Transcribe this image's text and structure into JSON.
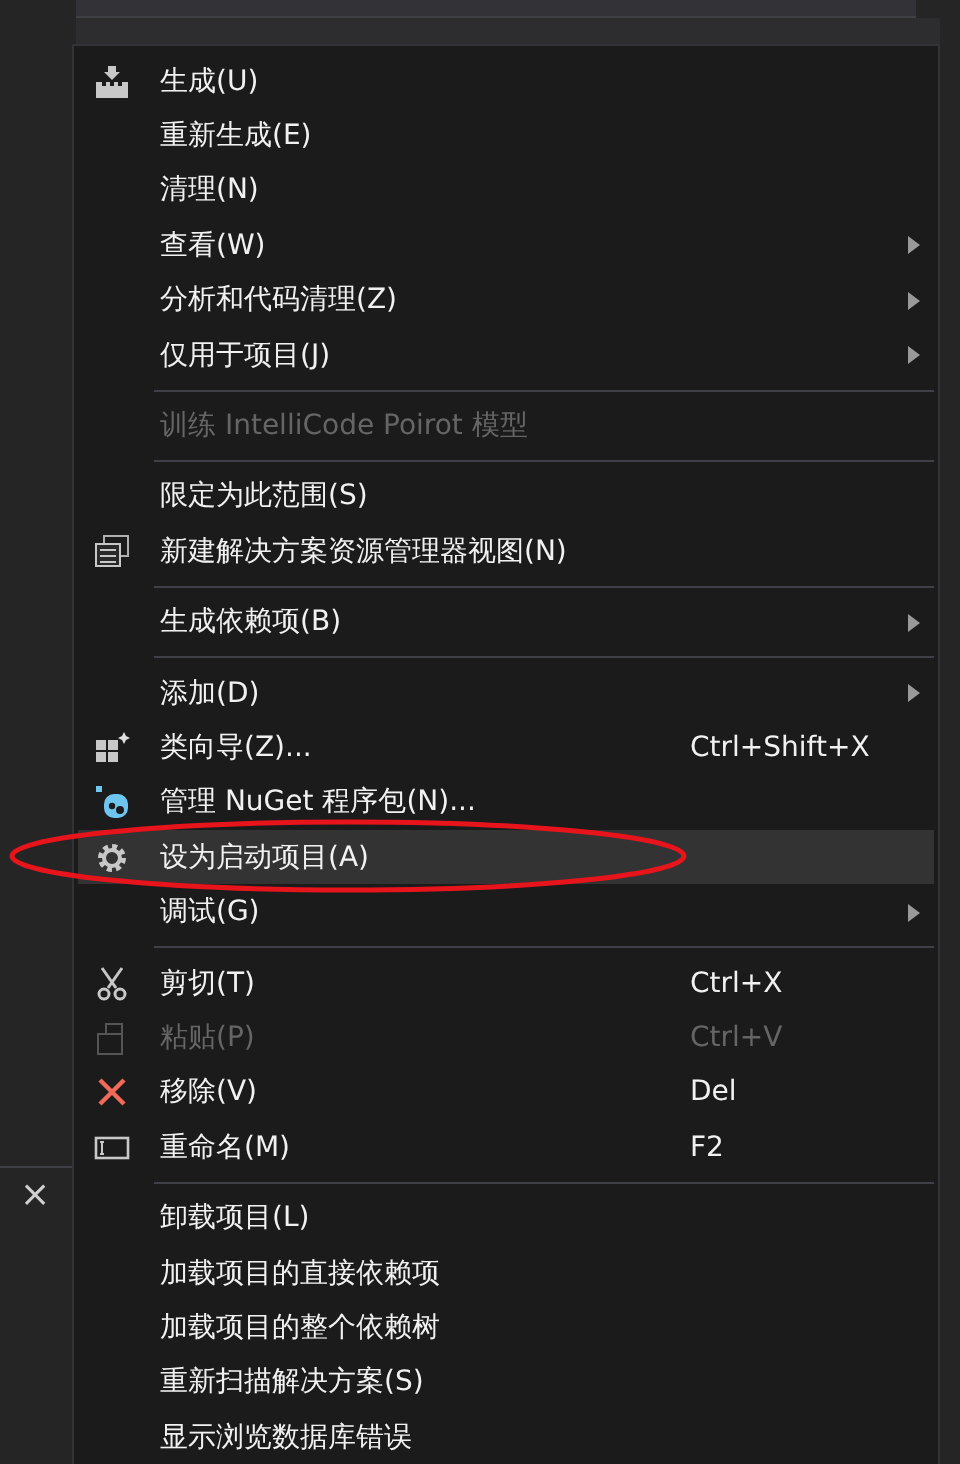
{
  "pane": {
    "close": "×"
  },
  "menu": {
    "groups": [
      {
        "items": [
          {
            "kind": "build",
            "label": "生成(U)",
            "disabled": false,
            "selected": false,
            "submenu": false
          },
          {
            "kind": "plain",
            "label": "重新生成(E)",
            "disabled": false,
            "selected": false,
            "submenu": false
          },
          {
            "kind": "plain",
            "label": "清理(N)",
            "disabled": false,
            "selected": false,
            "submenu": false
          },
          {
            "kind": "plain",
            "label": "查看(W)",
            "disabled": false,
            "selected": false,
            "submenu": true
          },
          {
            "kind": "plain",
            "label": "分析和代码清理(Z)",
            "disabled": false,
            "selected": false,
            "submenu": true
          },
          {
            "kind": "plain",
            "label": "仅用于项目(J)",
            "disabled": false,
            "selected": false,
            "submenu": true
          }
        ]
      },
      {
        "items": [
          {
            "kind": "plain",
            "label": "训练 IntelliCode Poirot 模型",
            "disabled": true,
            "selected": false,
            "submenu": false
          }
        ]
      },
      {
        "items": [
          {
            "kind": "plain",
            "label": "限定为此范围(S)",
            "disabled": false,
            "selected": false,
            "submenu": false
          },
          {
            "kind": "view",
            "label": "新建解决方案资源管理器视图(N)",
            "disabled": false,
            "selected": false,
            "submenu": false
          }
        ]
      },
      {
        "items": [
          {
            "kind": "plain",
            "label": "生成依赖项(B)",
            "disabled": false,
            "selected": false,
            "submenu": true
          }
        ]
      },
      {
        "items": [
          {
            "kind": "plain",
            "label": "添加(D)",
            "disabled": false,
            "selected": false,
            "submenu": true
          },
          {
            "kind": "class",
            "label": "类向导(Z)...",
            "shortcut": "Ctrl+Shift+X",
            "disabled": false,
            "selected": false,
            "submenu": false
          },
          {
            "kind": "nuget",
            "label": "管理 NuGet 程序包(N)...",
            "disabled": false,
            "selected": false,
            "submenu": false
          },
          {
            "kind": "gear",
            "label": "设为启动项目(A)",
            "disabled": false,
            "selected": true,
            "submenu": false
          },
          {
            "kind": "plain",
            "label": "调试(G)",
            "disabled": false,
            "selected": false,
            "submenu": true
          }
        ]
      },
      {
        "items": [
          {
            "kind": "cut",
            "label": "剪切(T)",
            "shortcut": "Ctrl+X",
            "disabled": false,
            "selected": false,
            "submenu": false
          },
          {
            "kind": "paste",
            "label": "粘贴(P)",
            "shortcut": "Ctrl+V",
            "disabled": true,
            "selected": false,
            "submenu": false
          },
          {
            "kind": "remove",
            "label": "移除(V)",
            "shortcut": "Del",
            "disabled": false,
            "selected": false,
            "submenu": false
          },
          {
            "kind": "rename",
            "label": "重命名(M)",
            "shortcut": "F2",
            "disabled": false,
            "selected": false,
            "submenu": false
          }
        ]
      },
      {
        "items": [
          {
            "kind": "plain",
            "label": "卸载项目(L)",
            "disabled": false,
            "selected": false,
            "submenu": false
          },
          {
            "kind": "plain",
            "label": "加载项目的直接依赖项",
            "disabled": false,
            "selected": false,
            "submenu": false
          },
          {
            "kind": "plain",
            "label": "加载项目的整个依赖树",
            "disabled": false,
            "selected": false,
            "submenu": false
          },
          {
            "kind": "plain",
            "label": "重新扫描解决方案(S)",
            "disabled": false,
            "selected": false,
            "submenu": false
          },
          {
            "kind": "plain",
            "label": "显示浏览数据库错误",
            "disabled": false,
            "selected": false,
            "submenu": false
          }
        ]
      }
    ]
  }
}
